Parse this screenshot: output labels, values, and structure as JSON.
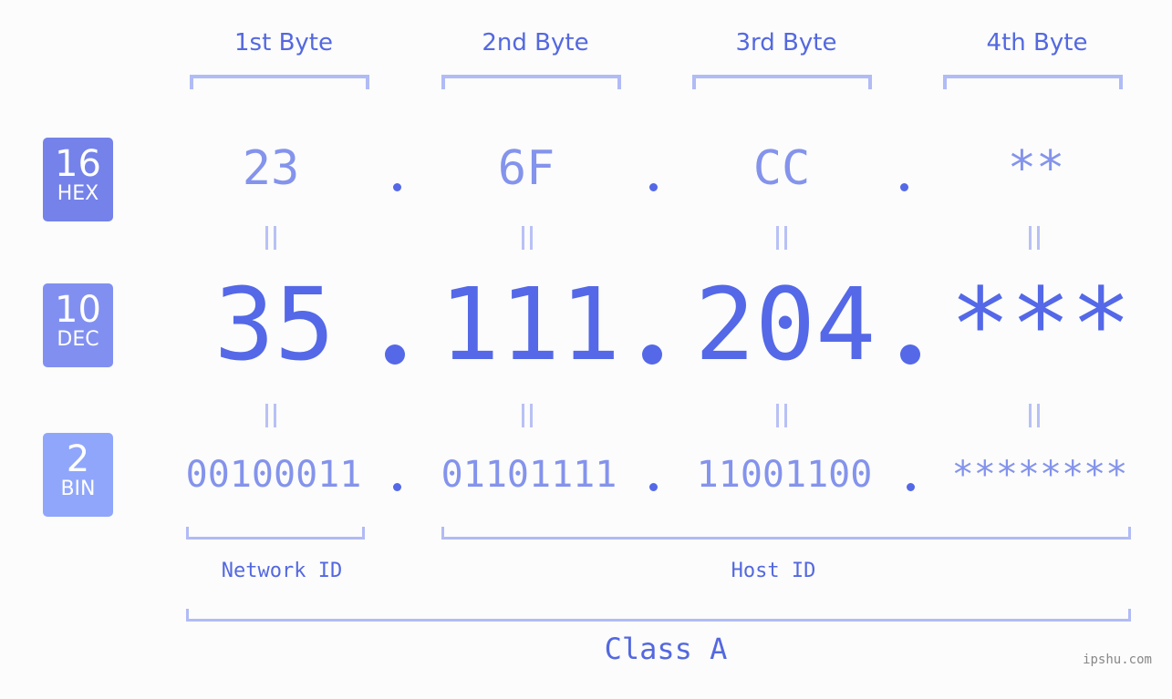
{
  "bytes": [
    {
      "label": "1st Byte",
      "hex": "23",
      "dec": "35",
      "bin": "00100011"
    },
    {
      "label": "2nd Byte",
      "hex": "6F",
      "dec": "111",
      "bin": "01101111"
    },
    {
      "label": "3rd Byte",
      "hex": "CC",
      "dec": "204",
      "bin": "11001100"
    },
    {
      "label": "4th Byte",
      "hex": "**",
      "dec": "***",
      "bin": "********"
    }
  ],
  "badges": {
    "hex": {
      "num": "16",
      "unit": "HEX",
      "color": "#7482ea"
    },
    "dec": {
      "num": "10",
      "unit": "DEC",
      "color": "#8190f0"
    },
    "bin": {
      "num": "2",
      "unit": "BIN",
      "color": "#8fa6fb"
    }
  },
  "segments": {
    "network": "Network ID",
    "host": "Host ID",
    "class": "Class A"
  },
  "watermark": "ipshu.com",
  "colors": {
    "accent": "#5468e8",
    "light": "#8493ec",
    "bracket": "#b1bbf6"
  }
}
